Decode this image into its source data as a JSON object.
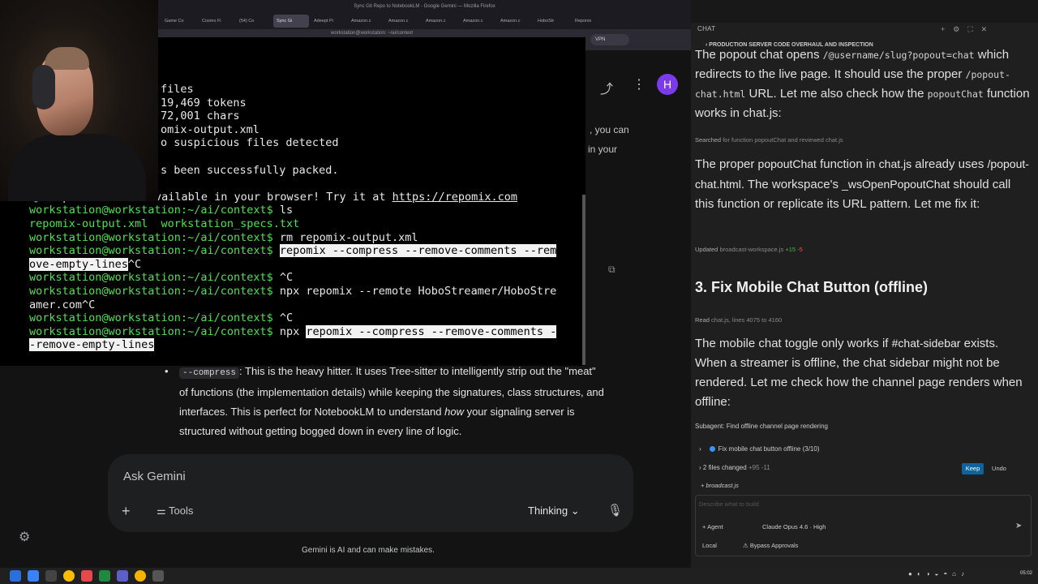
{
  "browser": {
    "window_title": "Sync Git Repo to NotebookLM - Google Gemini — Mozilla Firefox",
    "tabs": [
      "Game Co",
      "Cosmo Fi",
      "(54) Co",
      "Sync Gi",
      "Adeept Pi",
      "Amazon.c",
      "Amazon.c",
      "Amazon.c",
      "Amazon.c",
      "Amazon.c",
      "HoboStr",
      "Reponix"
    ],
    "active_tab_index": 3,
    "vpn_label": "VPN"
  },
  "terminal": {
    "title": "workstation@workstation: ~/ai/context",
    "lines": [
      {
        "segs": [
          {
            "t": "files"
          }
        ]
      },
      {
        "segs": [
          {
            "t": "19,469 tokens"
          }
        ]
      },
      {
        "segs": [
          {
            "t": "72,001 chars"
          }
        ]
      },
      {
        "segs": [
          {
            "t": "omix-output.xml"
          }
        ]
      },
      {
        "segs": [
          {
            "t": "o suspicious files detected"
          }
        ]
      },
      {
        "segs": [
          {
            "t": ""
          }
        ]
      },
      {
        "segs": [
          {
            "t": "s been successfully packed."
          }
        ]
      },
      {
        "segs": [
          {
            "t": ""
          }
        ]
      },
      {
        "segs": [
          {
            "t": "💡 Repomix is now available in your browser! Try it at "
          },
          {
            "t": "https://repomix.com",
            "c": "link"
          }
        ]
      },
      {
        "segs": [
          {
            "t": "workstation@workstation:~/ai/context$",
            "c": "prompt"
          },
          {
            "t": " ls"
          }
        ]
      },
      {
        "segs": [
          {
            "t": "repomix-output.xml  workstation_specs.txt",
            "c": "prompt"
          }
        ]
      },
      {
        "segs": [
          {
            "t": "workstation@workstation:~/ai/context$",
            "c": "prompt"
          },
          {
            "t": " rm repomix-output.xml"
          }
        ]
      },
      {
        "segs": [
          {
            "t": "workstation@workstation:~/ai/context$",
            "c": "prompt"
          },
          {
            "t": " "
          },
          {
            "t": "repomix --compress --remove-comments --rem",
            "c": "sel"
          }
        ]
      },
      {
        "segs": [
          {
            "t": "ove-empty-lines",
            "c": "sel"
          },
          {
            "t": "^C"
          }
        ]
      },
      {
        "segs": [
          {
            "t": "workstation@workstation:~/ai/context$",
            "c": "prompt"
          },
          {
            "t": " ^C"
          }
        ]
      },
      {
        "segs": [
          {
            "t": "workstation@workstation:~/ai/context$",
            "c": "prompt"
          },
          {
            "t": " npx repomix --remote HoboStreamer/HoboStre"
          }
        ]
      },
      {
        "segs": [
          {
            "t": "amer.com^C"
          }
        ]
      },
      {
        "segs": [
          {
            "t": "workstation@workstation:~/ai/context$",
            "c": "prompt"
          },
          {
            "t": " ^C"
          }
        ]
      },
      {
        "segs": [
          {
            "t": "workstation@workstation:~/ai/context$",
            "c": "prompt"
          },
          {
            "t": " npx "
          },
          {
            "t": "repomix --compress --remove-comments -",
            "c": "sel"
          }
        ]
      },
      {
        "segs": [
          {
            "t": "-remove-empty-lines",
            "c": "sel"
          }
        ]
      }
    ]
  },
  "gemini": {
    "avatar_letter": "H",
    "side_text_1": ", you can",
    "side_text_2": "in your",
    "response_code": "--compress",
    "response_a": ": This is the heavy hitter. It uses Tree-sitter to intelligently strip out the \"meat\" of functions (the implementation details) while keeping the signatures, class structures, and interfaces. This is perfect for NotebookLM to understand ",
    "response_em": "how",
    "response_b": " your signaling server is structured without getting bogged down in every line of logic.",
    "ask_placeholder": "Ask Gemini",
    "tools_label": "Tools",
    "thinking_label": "Thinking",
    "disclaimer": "Gemini is AI and can make mistakes."
  },
  "chat": {
    "header": "CHAT",
    "subtitle": "PRODUCTION SERVER CODE OVERHAUL AND INSPECTION",
    "p1_a": "The popout chat opens ",
    "p1_code1": "/@username/slug?popout=chat",
    "p1_b": " which redirects to the live page. It should use the proper ",
    "p1_code2": "/popout-chat.html",
    "p1_c": " URL. Let me also check how the ",
    "p1_code3": "popoutChat",
    "p1_d": " function works in chat.js:",
    "meta1_a": "Searched",
    "meta1_b": " for function popoutChat and reviewed chat.js",
    "p2_a": "The proper ",
    "p2_chip1": "popoutChat",
    "p2_b": " function in ",
    "p2_chip2": "chat.js",
    "p2_c": " already uses ",
    "p2_chip3": "/popout-chat.html",
    "p2_d": ". The workspace's ",
    "p2_chip4": "_wsOpenPopoutChat",
    "p2_e": " should call this function or replicate its URL pattern. Let me fix it:",
    "meta2_a": "Updated",
    "meta2_b": " broadcast-workspace.js ",
    "meta2_add": "+15",
    "meta2_del": "-5",
    "heading3": "3. Fix Mobile Chat Button (offline)",
    "meta3_a": "Read",
    "meta3_b": " chat.js, lines 4075 to 4160",
    "p3_a": "The mobile chat toggle only works if ",
    "p3_chip": "#chat-sidebar",
    "p3_b": " exists. When a streamer is offline, the chat sidebar might not be rendered. Let me check how the channel page renders when offline:",
    "subagent": "Subagent: Find offline channel page rendering",
    "todo": "Fix mobile chat button offline (3/10)",
    "files_changed": "2 files changed",
    "files_add": "+95",
    "files_del": "-11",
    "keep": "Keep",
    "undo": "Undo",
    "file_chip": "broadcast.js",
    "prompt_placeholder": "Describe what to build",
    "agent": "Agent",
    "model": "Claude Opus 4.6 · High",
    "local": "Local",
    "bypass": "Bypass Approvals"
  },
  "taskbar": {
    "clock": "05:02"
  }
}
